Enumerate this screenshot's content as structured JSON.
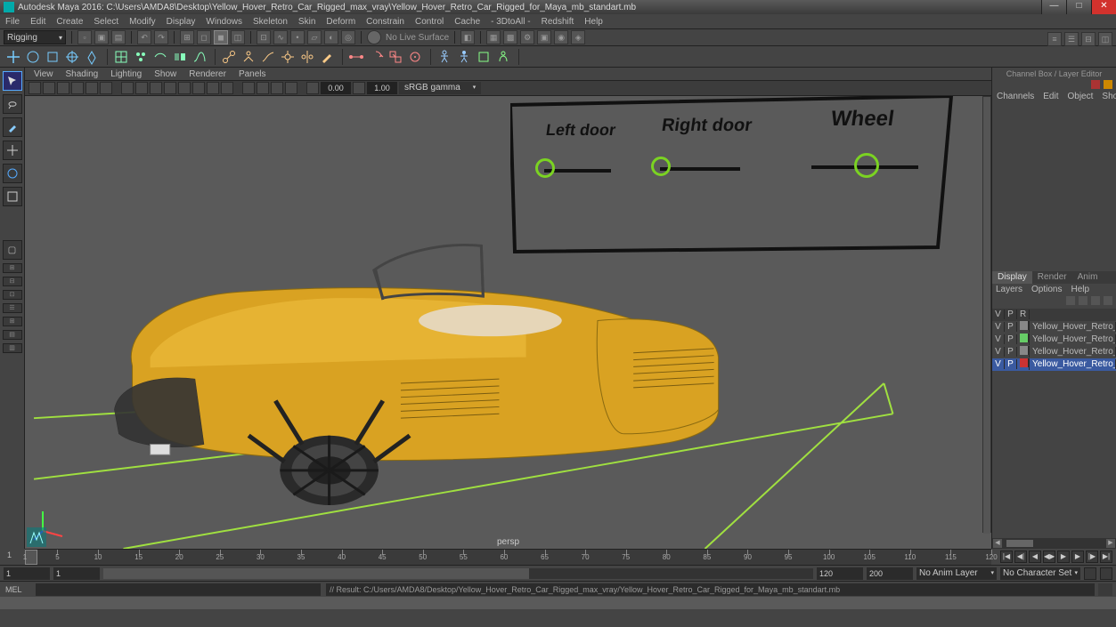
{
  "title_bar": "Autodesk Maya 2016: C:\\Users\\AMDA8\\Desktop\\Yellow_Hover_Retro_Car_Rigged_max_vray\\Yellow_Hover_Retro_Car_Rigged_for_Maya_mb_standart.mb",
  "menus": [
    "File",
    "Edit",
    "Create",
    "Select",
    "Modify",
    "Display",
    "Windows",
    "Skeleton",
    "Skin",
    "Deform",
    "Constrain",
    "Control",
    "Cache",
    "- 3DtoAll -",
    "Redshift",
    "Help"
  ],
  "mode_selector": "Rigging",
  "no_live_surface": "No Live Surface",
  "viewport_menus": [
    "View",
    "Shading",
    "Lighting",
    "Show",
    "Renderer",
    "Panels"
  ],
  "exposure_value": "0.00",
  "gamma_value": "1.00",
  "colorspace": "sRGB gamma",
  "camera_label": "persp",
  "right_panel": {
    "title": "Channel Box / Layer Editor",
    "top_tabs": [
      "Channels",
      "Edit",
      "Object",
      "Show"
    ],
    "mid_tabs": [
      "Display",
      "Render",
      "Anim"
    ],
    "layer_menu": [
      "Layers",
      "Options",
      "Help"
    ],
    "layer_header": [
      "V",
      "P",
      "R",
      ""
    ],
    "layers": [
      {
        "v": "V",
        "p": "P",
        "color": "#888888",
        "name": "Yellow_Hover_Retro_Car",
        "sel": false
      },
      {
        "v": "V",
        "p": "P",
        "color": "#66cc66",
        "name": "Yellow_Hover_Retro_C:",
        "sel": false
      },
      {
        "v": "V",
        "p": "P",
        "color": "#888888",
        "name": "Yellow_Hover_Retro_C:",
        "sel": false
      },
      {
        "v": "V",
        "p": "P",
        "color": "#cc3333",
        "name": "Yellow_Hover_Retro_C:",
        "sel": true
      }
    ]
  },
  "timeline": {
    "start_display": "1",
    "ticks": [
      1,
      5,
      10,
      15,
      20,
      25,
      30,
      35,
      40,
      45,
      50,
      55,
      60,
      65,
      70,
      75,
      80,
      85,
      90,
      95,
      100,
      105,
      110,
      115,
      120
    ],
    "range_start": "1",
    "playback_start": "1",
    "playback_end": "120",
    "range_end": "200",
    "anim_layer": "No Anim Layer",
    "char_set": "No Character Set"
  },
  "command": {
    "lang": "MEL",
    "result": "// Result: C:/Users/AMDA8/Desktop/Yellow_Hover_Retro_Car_Rigged_max_vray/Yellow_Hover_Retro_Car_Rigged_for_Maya_mb_standart.mb"
  },
  "controls_panel": {
    "left_door": "Left door",
    "right_door": "Right door",
    "wheel": "Wheel"
  }
}
